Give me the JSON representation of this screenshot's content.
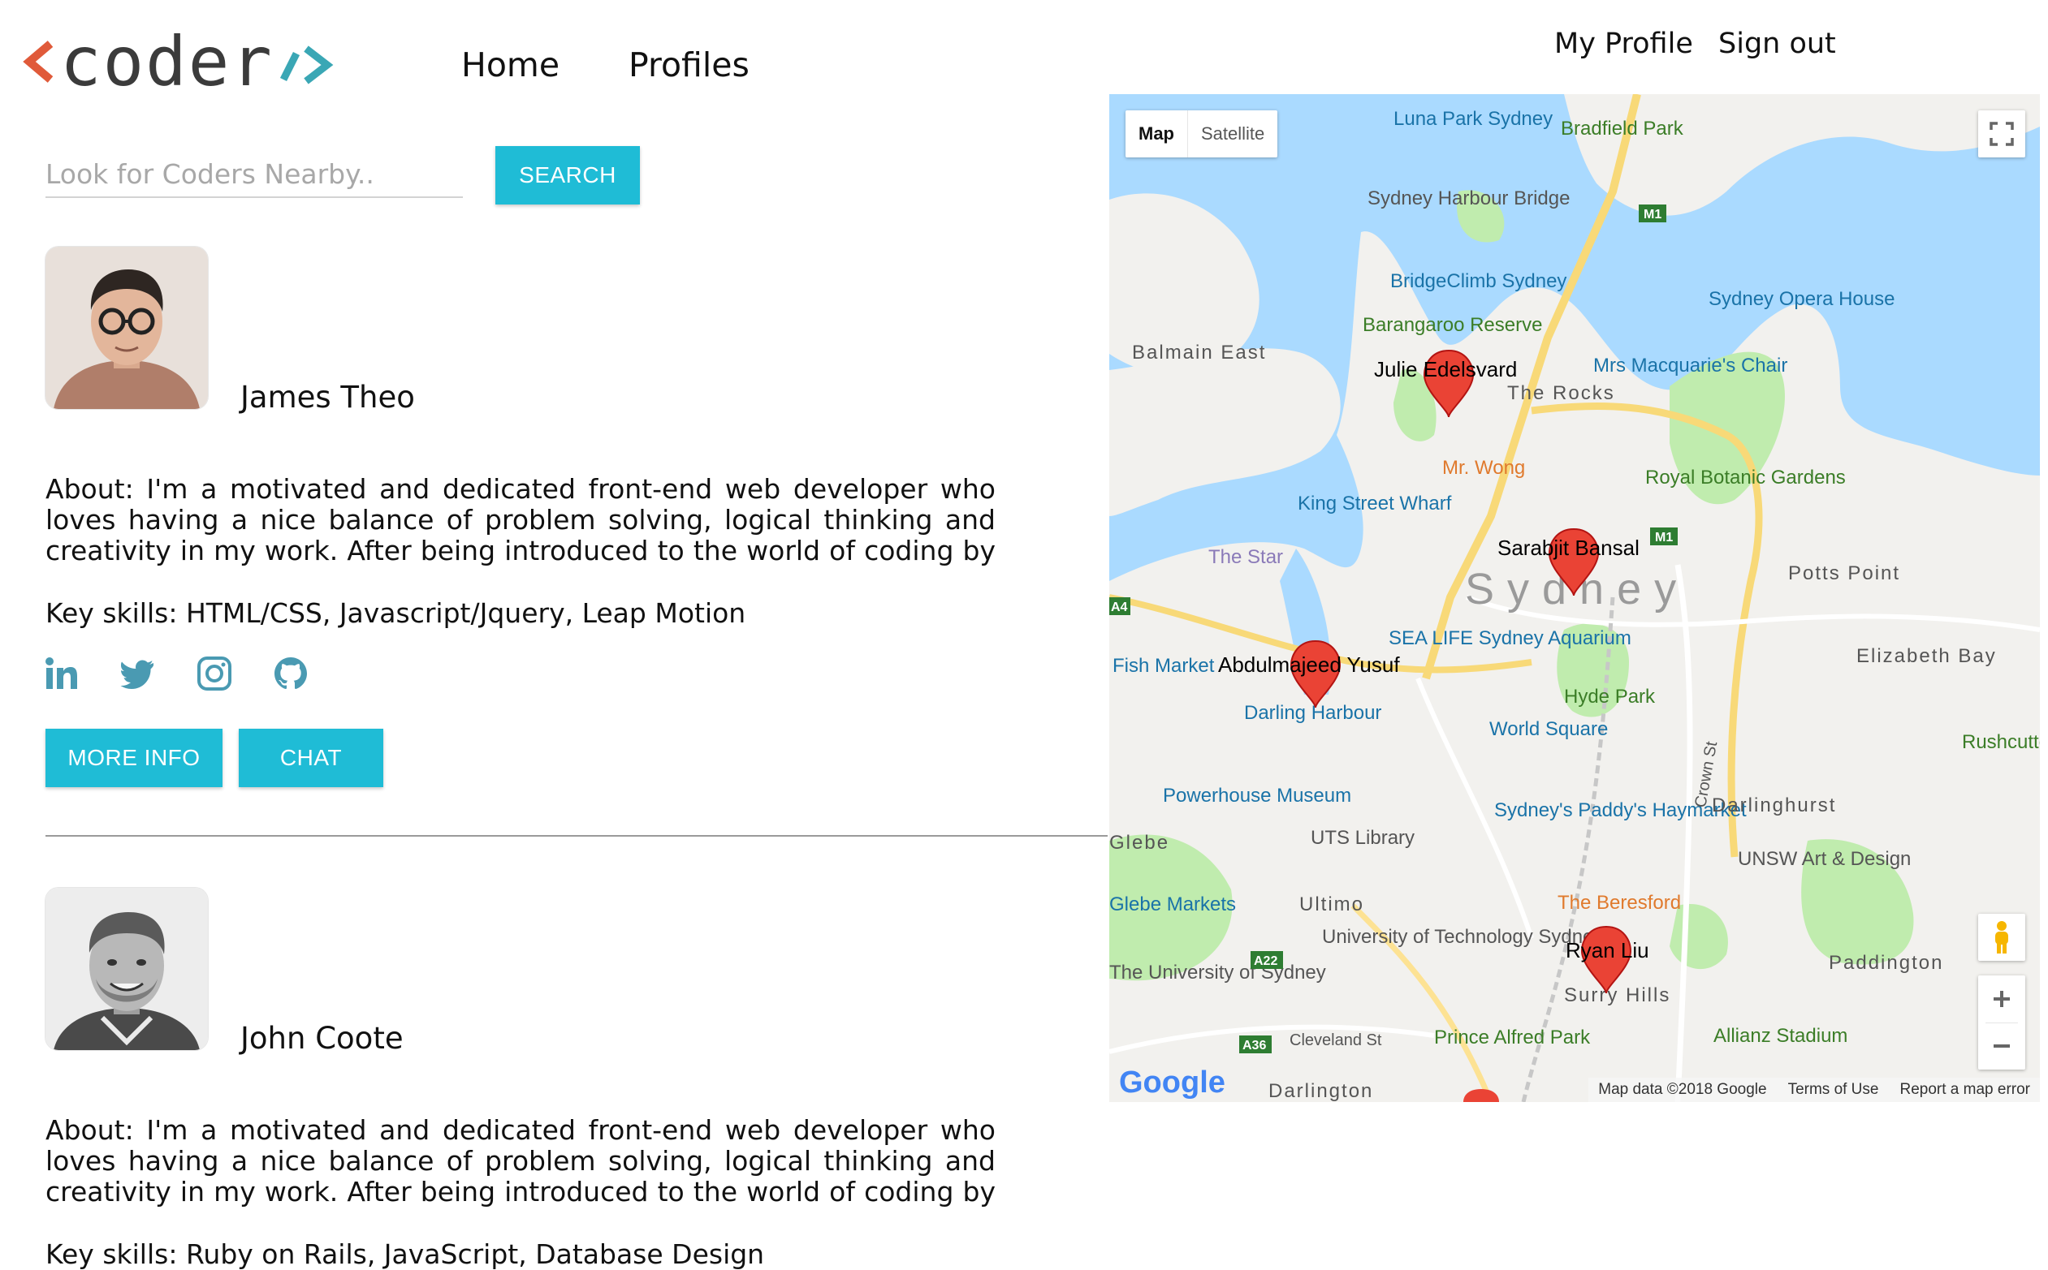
{
  "header": {
    "logo_text": "coder",
    "nav": [
      "Home",
      "Profiles"
    ],
    "user_nav": [
      "My Profile",
      "Sign out"
    ]
  },
  "search": {
    "placeholder": "Look for Coders Nearby..",
    "value": "",
    "button_label": "SEARCH"
  },
  "profiles": [
    {
      "name": "James Theo",
      "about_label": "About:",
      "about_text": "I'm a motivated and dedicated front-end web developer who loves having a nice balance of problem solving, logical thinking and creativity in my work. After being introduced to the world of coding by close friends, I realised ...",
      "skills_label": "Key skills:",
      "skills_text": "HTML/CSS, Javascript/Jquery, Leap Motion",
      "social_icons": [
        "linkedin-icon",
        "twitter-icon",
        "instagram-icon",
        "github-icon"
      ],
      "more_info_label": "MORE INFO",
      "chat_label": "CHAT"
    },
    {
      "name": "John Coote",
      "about_label": "About:",
      "about_text": "I'm a motivated and dedicated front-end web developer who loves having a nice balance of problem solving, logical thinking and creativity in my work. After being introduced to the world of coding by close friends, I realised ...",
      "skills_label": "Key skills:",
      "skills_text": "Ruby on Rails, JavaScript, Database Design"
    }
  ],
  "map": {
    "type_options": [
      "Map",
      "Satellite"
    ],
    "selected_type": "Map",
    "markers": [
      "Julie Edelsvard",
      "Sarabjit Bansal",
      "Abdulmajeed Yusuf",
      "Ryan Liu"
    ],
    "places": [
      "Luna Park Sydney",
      "Bradfield Park",
      "Sydney Harbour Bridge",
      "BridgeClimb Sydney",
      "Sydney Opera House",
      "Barangaroo Reserve",
      "Balmain East",
      "Mrs Macquarie's Chair",
      "The Rocks",
      "Mr. Wong",
      "Royal Botanic Gardens",
      "King Street Wharf",
      "The Star",
      "Potts Point",
      "Sydney",
      "SEA LIFE Sydney Aquarium",
      "Fish Market",
      "Elizabeth Bay",
      "Hyde Park",
      "Darling Harbour",
      "World Square",
      "Rushcutters Bay Park",
      "Powerhouse Museum",
      "Sydney's Paddy's Haymarket",
      "Darlinghurst",
      "UTS Library",
      "Glebe",
      "UNSW Art & Design",
      "Glebe Markets",
      "Ultimo",
      "The Beresford",
      "University of Technology Sydney",
      "The University of Sydney",
      "Paddington",
      "Surry Hills",
      "Prince Alfred Park",
      "Allianz Stadium",
      "Darlington",
      "Cleveland St",
      "Crown St"
    ],
    "road_badges": [
      "M1",
      "M1",
      "A4",
      "A22",
      "A36"
    ],
    "footer": {
      "brand": "Google",
      "map_data": "Map data ©2018 Google",
      "terms": "Terms of Use",
      "report": "Report a map error"
    },
    "colors": {
      "water": "#aadaff",
      "park": "#c0ecae",
      "land": "#f2f1ee",
      "marker": "#ea4335",
      "accent": "#1fbcd6"
    }
  }
}
